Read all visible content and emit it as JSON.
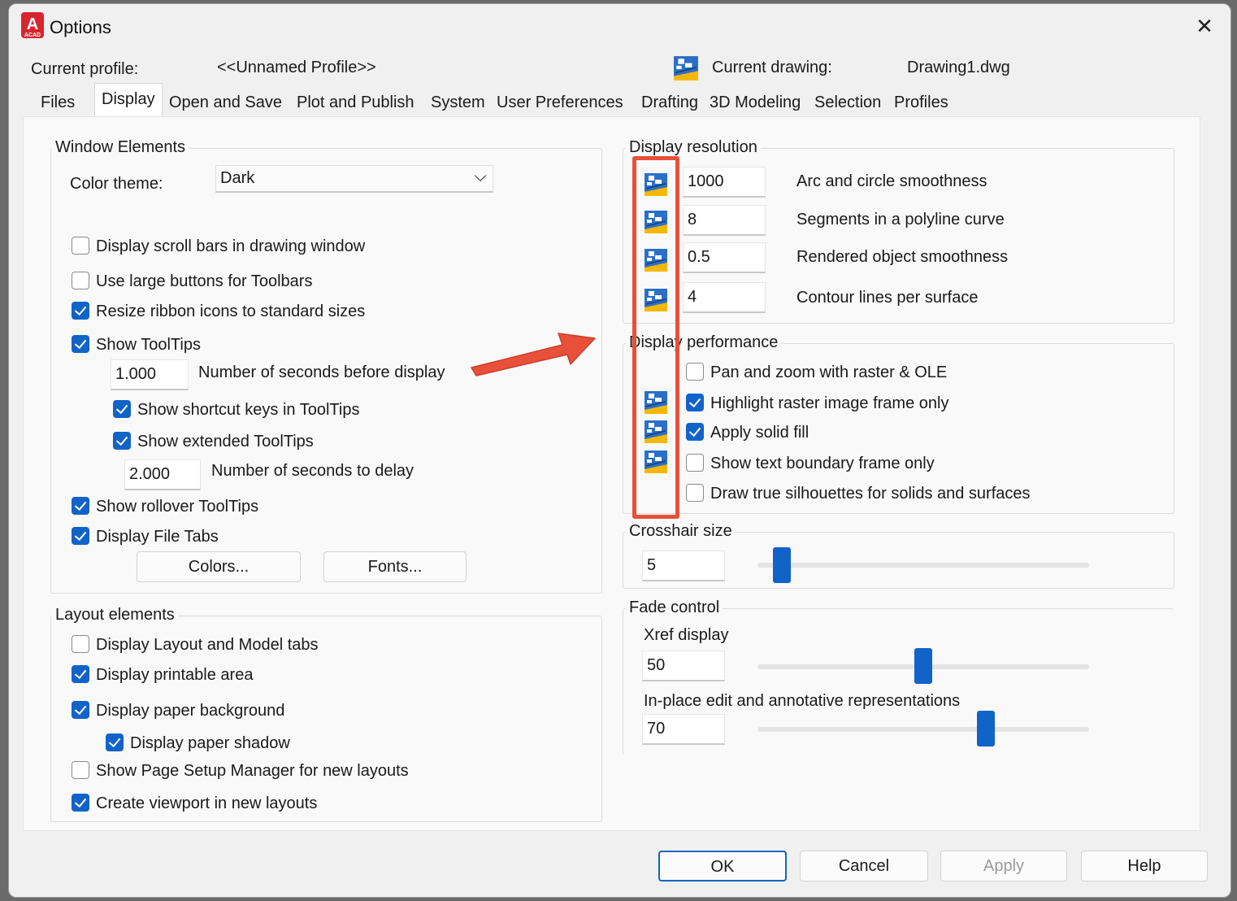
{
  "window": {
    "title": "Options",
    "app_icon_letter": "A",
    "app_icon_sub": "ACAD",
    "close_glyph": "✕"
  },
  "profile": {
    "label": "Current profile:",
    "value": "<<Unnamed Profile>>"
  },
  "drawing": {
    "label": "Current drawing:",
    "value": "Drawing1.dwg"
  },
  "tabs": [
    {
      "label": "Files"
    },
    {
      "label": "Display",
      "active": true
    },
    {
      "label": "Open and Save"
    },
    {
      "label": "Plot and Publish"
    },
    {
      "label": "System"
    },
    {
      "label": "User Preferences"
    },
    {
      "label": "Drafting"
    },
    {
      "label": "3D Modeling"
    },
    {
      "label": "Selection"
    },
    {
      "label": "Profiles"
    }
  ],
  "window_elements": {
    "title": "Window Elements",
    "color_theme_label": "Color theme:",
    "color_theme_value": "Dark",
    "scroll_bars": {
      "label": "Display scroll bars in drawing window",
      "checked": false
    },
    "large_buttons": {
      "label": "Use large buttons for Toolbars",
      "checked": false
    },
    "resize_ribbon": {
      "label": "Resize ribbon icons to standard sizes",
      "checked": true
    },
    "show_tooltips": {
      "label": "Show ToolTips",
      "checked": true
    },
    "seconds_before_display": {
      "value": "1.000",
      "label": "Number of seconds before display"
    },
    "shortcut_keys": {
      "label": "Show shortcut keys in ToolTips",
      "checked": true
    },
    "extended_tooltips": {
      "label": "Show extended ToolTips",
      "checked": true
    },
    "seconds_to_delay": {
      "value": "2.000",
      "label": "Number of seconds to delay"
    },
    "rollover_tooltips": {
      "label": "Show rollover ToolTips",
      "checked": true
    },
    "file_tabs": {
      "label": "Display File Tabs",
      "checked": true
    },
    "colors_button": "Colors...",
    "fonts_button": "Fonts..."
  },
  "layout_elements": {
    "title": "Layout elements",
    "layout_model_tabs": {
      "label": "Display Layout and Model tabs",
      "checked": false
    },
    "printable_area": {
      "label": "Display printable area",
      "checked": true
    },
    "paper_background": {
      "label": "Display paper background",
      "checked": true
    },
    "paper_shadow": {
      "label": "Display paper shadow",
      "checked": true
    },
    "page_setup_manager": {
      "label": "Show Page Setup Manager for new layouts",
      "checked": false
    },
    "create_viewport": {
      "label": "Create viewport in new layouts",
      "checked": true
    }
  },
  "display_resolution": {
    "title": "Display resolution",
    "rows": [
      {
        "value": "1000",
        "label": "Arc and circle smoothness"
      },
      {
        "value": "8",
        "label": "Segments in a polyline curve"
      },
      {
        "value": "0.5",
        "label": "Rendered object smoothness"
      },
      {
        "value": "4",
        "label": "Contour lines per surface"
      }
    ]
  },
  "display_performance": {
    "title": "Display performance",
    "items": [
      {
        "label": "Pan and zoom with raster & OLE",
        "checked": false
      },
      {
        "label": "Highlight raster image frame only",
        "checked": true
      },
      {
        "label": "Apply solid fill",
        "checked": true
      },
      {
        "label": "Show text boundary frame only",
        "checked": false
      },
      {
        "label": "Draw true silhouettes for solids and surfaces",
        "checked": false
      }
    ]
  },
  "crosshair": {
    "title": "Crosshair size",
    "value": "5",
    "level_percent": 5
  },
  "fade_control": {
    "title": "Fade control",
    "xref_label": "Xref display",
    "xref_value": "50",
    "xref_level_percent": 50,
    "inplace_label": "In-place edit and annotative representations",
    "inplace_value": "70",
    "inplace_level_percent": 70
  },
  "buttons": {
    "ok": "OK",
    "cancel": "Cancel",
    "apply": "Apply",
    "help": "Help"
  },
  "colors": {
    "accent": "#1263c8",
    "annotation": "#e8503a",
    "app_icon": "#d7262f"
  },
  "icons": {
    "drawing_saved_icon": "drawing-saved-icon",
    "annotation_arrow": "arrow-annotation"
  }
}
